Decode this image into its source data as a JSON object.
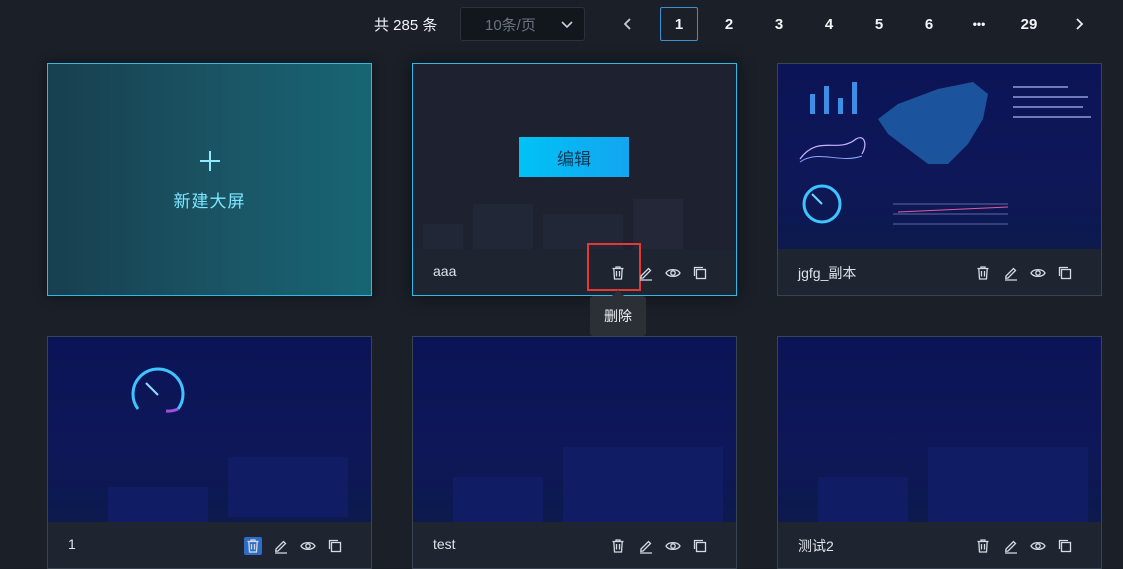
{
  "pagination": {
    "total_label": "共 285 条",
    "page_size": "10条/页",
    "pages": [
      "1",
      "2",
      "3",
      "4",
      "5",
      "6",
      "•••",
      "29"
    ],
    "current": "1"
  },
  "new_card": {
    "label": "新建大屏"
  },
  "cards": [
    {
      "name": "aaa",
      "overlay_button": "编辑"
    },
    {
      "name": "jgfg_副本"
    },
    {
      "name": "1"
    },
    {
      "name": "test"
    },
    {
      "name": "测试2"
    }
  ],
  "tooltip": {
    "text": "删除"
  },
  "colors": {
    "accent": "#2fb8e8",
    "highlight_red": "#e53935",
    "highlight_blue": "#2f6cc8",
    "thumb_navy": "#0b1456"
  },
  "icons": [
    "chevron-down-icon",
    "chevron-left-icon",
    "chevron-right-icon",
    "plus-icon",
    "delete-icon",
    "edit-icon",
    "preview-icon",
    "copy-icon"
  ]
}
